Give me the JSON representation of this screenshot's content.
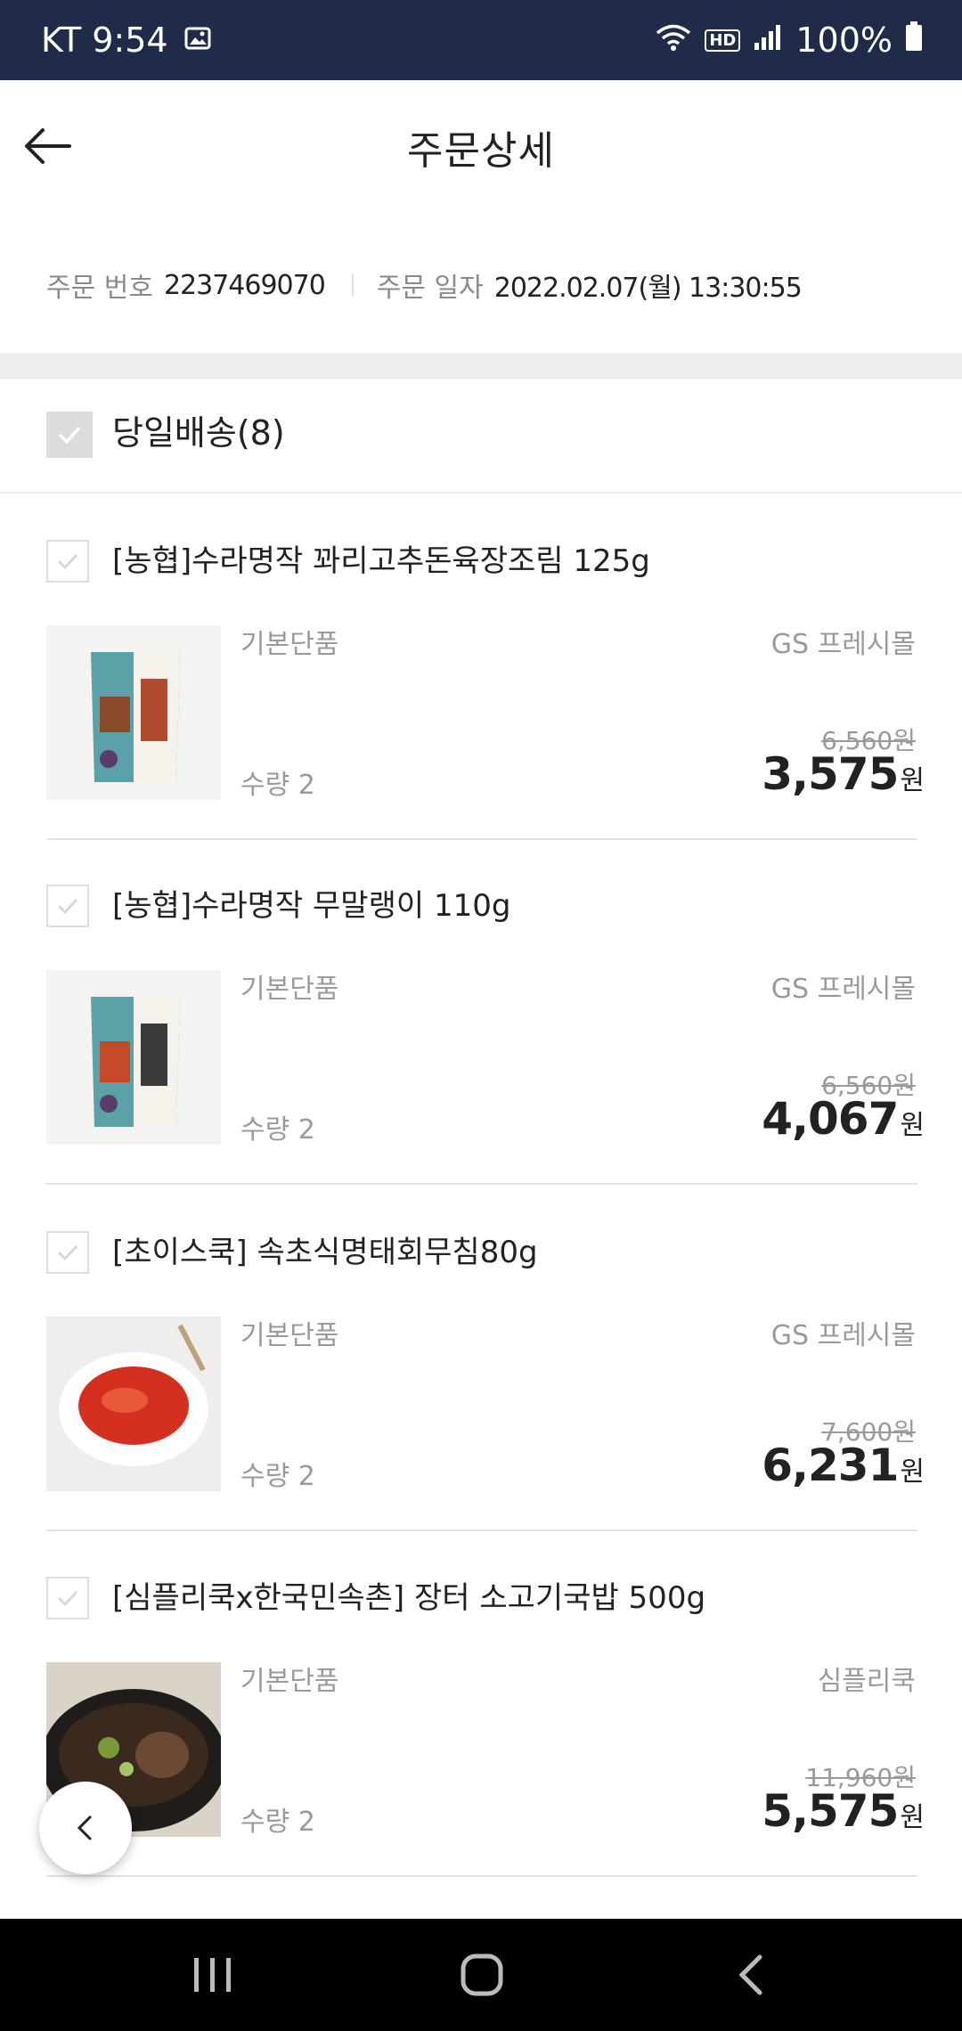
{
  "status_bar": {
    "carrier_time": "KT 9:54",
    "hd": "HD",
    "battery": "100%"
  },
  "header": {
    "title": "주문상세"
  },
  "order_info": {
    "number_label": "주문 번호",
    "number_value": "2237469070",
    "date_label": "주문 일자",
    "date_value": "2022.02.07(월) 13:30:55"
  },
  "group": {
    "label": "당일배송(8)"
  },
  "items": [
    {
      "name": "[농협]수라명작 꽈리고추돈육장조림 125g",
      "option": "기본단품",
      "seller": "GS 프레시몰",
      "qty": "수량 2",
      "original_price": "6,560원",
      "sale_price": "3,575",
      "unit": "원"
    },
    {
      "name": "[농협]수라명작 무말랭이 110g",
      "option": "기본단품",
      "seller": "GS 프레시몰",
      "qty": "수량 2",
      "original_price": "6,560원",
      "sale_price": "4,067",
      "unit": "원"
    },
    {
      "name": "[초이스쿡] 속초식명태회무침80g",
      "option": "기본단품",
      "seller": "GS 프레시몰",
      "qty": "수량 2",
      "original_price": "7,600원",
      "sale_price": "6,231",
      "unit": "원"
    },
    {
      "name": "[심플리쿡x한국민속촌] 장터 소고기국밥 500g",
      "option": "기본단품",
      "seller": "심플리쿡",
      "qty": "수량 2",
      "original_price": "11,960원",
      "sale_price": "5,575",
      "unit": "원"
    }
  ]
}
